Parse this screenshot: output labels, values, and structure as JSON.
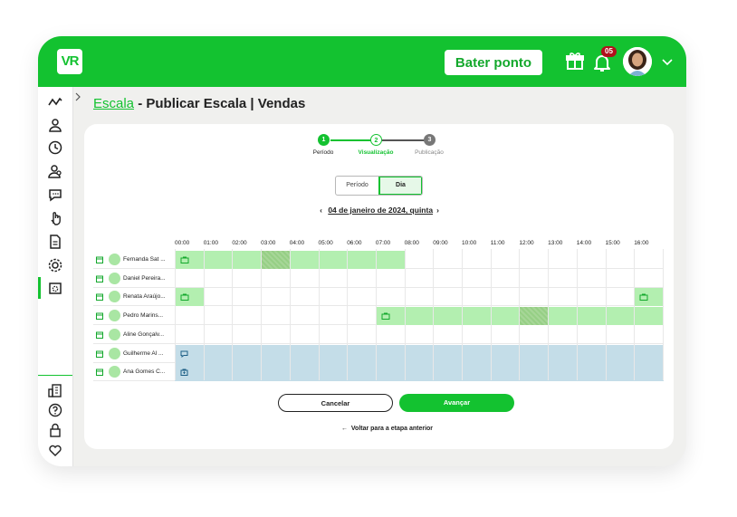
{
  "header": {
    "logo_text": "VR",
    "punch_button": "Bater ponto",
    "notification_count": "05",
    "brand_color": "#13c230"
  },
  "sidebar": {
    "items": [
      "activity-icon",
      "user-icon",
      "clock-icon",
      "team-icon",
      "chat-icon",
      "hand-icon",
      "document-icon",
      "settings-icon",
      "calendar-settings-icon"
    ],
    "bottom_items": [
      "building-icon",
      "help-icon",
      "lock-icon",
      "heart-icon"
    ],
    "active_item": "calendar-settings-icon"
  },
  "breadcrumb": {
    "link": "Escala",
    "title": " - Publicar Escala | Vendas"
  },
  "steps": [
    {
      "number": "1",
      "label": "Período",
      "state": "done"
    },
    {
      "number": "2",
      "label": "Visualização",
      "state": "current"
    },
    {
      "number": "3",
      "label": "Publicação",
      "state": "pending"
    }
  ],
  "view_toggle": {
    "options": [
      "Período",
      "Dia"
    ],
    "selected": "Dia"
  },
  "date_nav": {
    "date": "04 de janeiro de 2024, quinta",
    "prev": "‹",
    "next": "›"
  },
  "schedule": {
    "hours": [
      "00:00",
      "01:00",
      "02:00",
      "03:00",
      "04:00",
      "05:00",
      "06:00",
      "07:00",
      "08:00",
      "09:00",
      "10:00",
      "11:00",
      "12:00",
      "13:00",
      "14:00",
      "15:00",
      "16:00"
    ],
    "employees": [
      {
        "name": "Fernanda Sat ..."
      },
      {
        "name": "Daniel Pereira..."
      },
      {
        "name": "Renata Araújo..."
      },
      {
        "name": "Pedro Marins..."
      },
      {
        "name": "Aline Gonçalv..."
      },
      {
        "name": "Guilherme Al ..."
      },
      {
        "name": "Ana Gomes C..."
      }
    ],
    "shifts": [
      {
        "row": 0,
        "start": 0,
        "end": 8,
        "kind": "work",
        "icon": "briefcase-icon"
      },
      {
        "row": 0,
        "start": 3,
        "end": 4,
        "kind": "break"
      },
      {
        "row": 2,
        "start": 0,
        "end": 1,
        "kind": "work",
        "icon": "briefcase-icon"
      },
      {
        "row": 2,
        "start": 16,
        "end": 17.1,
        "kind": "work",
        "icon": "briefcase-icon"
      },
      {
        "row": 3,
        "start": 7,
        "end": 17.1,
        "kind": "work",
        "icon": "briefcase-icon"
      },
      {
        "row": 3,
        "start": 12,
        "end": 13,
        "kind": "break"
      },
      {
        "row": 5,
        "start": 0,
        "end": 17.1,
        "kind": "leave",
        "icon": "chat-bubble-icon"
      },
      {
        "row": 6,
        "start": 0,
        "end": 17.1,
        "kind": "leave",
        "icon": "medical-bag-icon"
      }
    ],
    "colors": {
      "work": "#b3efb0",
      "break": "#96cf85",
      "leave": "#c4dde8",
      "icon": "#13a82c",
      "leave_icon": "#1d5f86"
    }
  },
  "actions": {
    "cancel": "Cancelar",
    "next": "Avançar",
    "back": "Voltar para a etapa anterior"
  }
}
